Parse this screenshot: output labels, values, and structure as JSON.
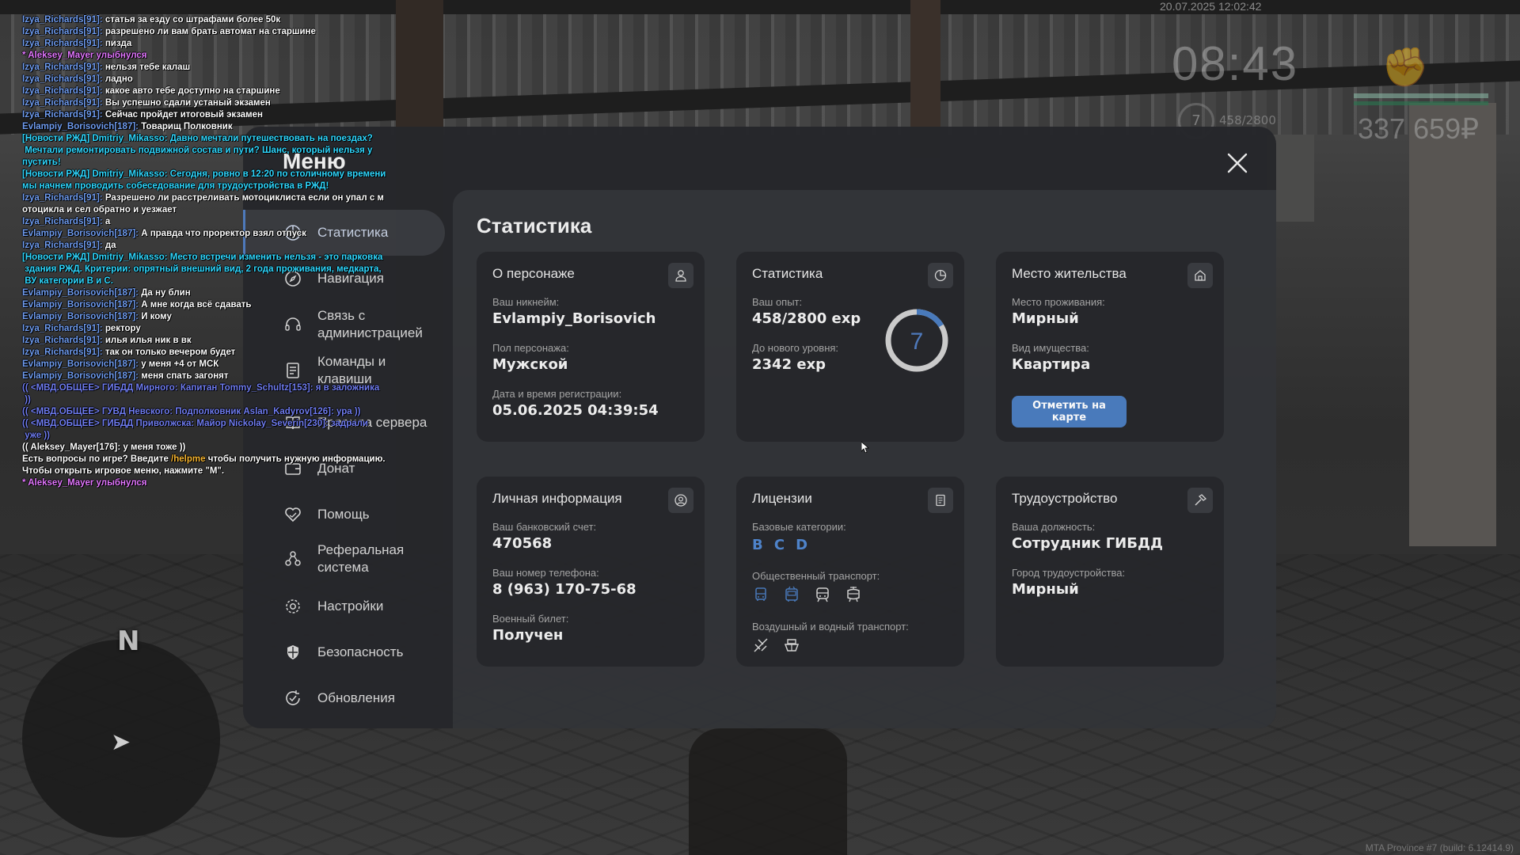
{
  "hud": {
    "datetime": "20.07.2025 12:02:42",
    "clock": "08:43",
    "level": "7",
    "exp": "458/2800",
    "money": "337 659₽",
    "build": "MTA Province #7 (build: 6.12414.9)",
    "compass_letter": "N",
    "fist_icon": "fist-icon"
  },
  "menu": {
    "title": "Меню",
    "section_title": "Статистика",
    "sidebar": [
      {
        "label": "Статистика",
        "icon": "pie-chart-icon",
        "active": true
      },
      {
        "label": "Навигация",
        "icon": "compass-icon",
        "active": false
      },
      {
        "label": "Связь с администрацией",
        "icon": "headset-icon",
        "active": false
      },
      {
        "label": "Команды и клавиши",
        "icon": "document-icon",
        "active": false
      },
      {
        "label": "Правила сервера",
        "icon": "book-icon",
        "active": false
      },
      {
        "label": "Донат",
        "icon": "wallet-icon",
        "active": false
      },
      {
        "label": "Помощь",
        "icon": "heart-hand-icon",
        "active": false
      },
      {
        "label": "Реферальная система",
        "icon": "users-icon",
        "active": false
      },
      {
        "label": "Настройки",
        "icon": "gear-icon",
        "active": false
      },
      {
        "label": "Безопасность",
        "icon": "shield-icon",
        "active": false
      },
      {
        "label": "Обновления",
        "icon": "refresh-check-icon",
        "active": false
      }
    ],
    "cards": {
      "character": {
        "title": "О персонаже",
        "nickname_label": "Ваш никнейм:",
        "nickname": "Evlampiy_Borisovich",
        "gender_label": "Пол персонажа:",
        "gender": "Мужской",
        "reg_label": "Дата и время регистрации:",
        "reg": "05.06.2025 04:39:54"
      },
      "stats": {
        "title": "Статистика",
        "exp_label": "Ваш опыт:",
        "exp": "458/2800 exp",
        "next_label": "До нового уровня:",
        "next": "2342 exp",
        "level": "7",
        "progress": 0.1636
      },
      "residence": {
        "title": "Место жительства",
        "place_label": "Место проживания:",
        "place": "Мирный",
        "property_label": "Вид имущества:",
        "property": "Квартира",
        "button": "Отметить на карте"
      },
      "personal": {
        "title": "Личная информация",
        "bank_label": "Ваш банковский счет:",
        "bank": "470568",
        "phone_label": "Ваш номер телефона:",
        "phone": "8 (963) 170-75-68",
        "military_label": "Военный билет:",
        "military": "Получен"
      },
      "licenses": {
        "title": "Лицензии",
        "base_label": "Базовые категории:",
        "categories": [
          "B",
          "C",
          "D"
        ],
        "public_label": "Общественный транспорт:",
        "public_icons": [
          "bus-icon",
          "trolleybus-icon",
          "train-icon",
          "tram-icon"
        ],
        "air_label": "Воздушный и водный транспорт:",
        "air_icons": [
          "plane-icon",
          "boat-icon"
        ]
      },
      "job": {
        "title": "Трудоустройство",
        "position_label": "Ваша должность:",
        "position": "Сотрудник ГИБДД",
        "city_label": "Город трудоустройства:",
        "city": "Мирный"
      }
    }
  },
  "chat": [
    {
      "cls": "c-name",
      "name": "Izya_Richards[91]:",
      "text": " статья за езду со штрафами более 50к"
    },
    {
      "cls": "c-name",
      "name": "Izya_Richards[91]:",
      "text": " разрешено ли вам брать автомат на старшине"
    },
    {
      "cls": "c-name",
      "name": "Izya_Richards[91]:",
      "text": " пизда"
    },
    {
      "cls": "c-me",
      "name": "",
      "text": "* Aleksey_Mayer улыбнулся"
    },
    {
      "cls": "c-name",
      "name": "Izya_Richards[91]:",
      "text": " нельзя тебе калаш"
    },
    {
      "cls": "c-name",
      "name": "Izya_Richards[91]:",
      "text": " ладно"
    },
    {
      "cls": "c-name",
      "name": "Izya_Richards[91]:",
      "text": " какое авто тебе доступно на старшине"
    },
    {
      "cls": "c-name",
      "name": "Izya_Richards[91]:",
      "text": " Вы успешно сдали устаный экзамен"
    },
    {
      "cls": "c-name",
      "name": "Izya_Richards[91]:",
      "text": " Сейчас пройдет итоговый экзамен"
    },
    {
      "cls": "c-name",
      "name": "Evlampiy_Borisovich[187]:",
      "text": " Товарищ Полковник"
    },
    {
      "cls": "c-news",
      "name": "",
      "text": "[Новости РЖД] Dmitriy_Mikasso: Давно мечтали путешествовать на поездах?\n Мечтали ремонтировать подвижной состав и пути? Шанс, который нельзя у\nпустить!"
    },
    {
      "cls": "c-news",
      "name": "",
      "text": "[Новости РЖД] Dmitriy_Mikasso: Сегодня, ровно в 12:20 по столичному времени\nмы начнем проводить собеседование для трудоустройства в РЖД!"
    },
    {
      "cls": "c-name",
      "name": "Izya_Richards[91]:",
      "text": " Разрешено ли расстреливать мотоциклиста если он упал с м\nотоцикла и сел обратно и уезжает"
    },
    {
      "cls": "c-name",
      "name": "Izya_Richards[91]:",
      "text": " а"
    },
    {
      "cls": "c-name",
      "name": "Evlampiy_Borisovich[187]:",
      "text": " А правда что проректор взял отпуск"
    },
    {
      "cls": "c-name",
      "name": "Izya_Richards[91]:",
      "text": " да"
    },
    {
      "cls": "c-news",
      "name": "",
      "text": "[Новости РЖД] Dmitriy_Mikasso: Место встречи изменить нельзя - это парковка\n здания РЖД. Критерии: опрятный внешний вид, 2 года проживания, медкарта,\n ВУ категории B и C."
    },
    {
      "cls": "c-name",
      "name": "Evlampiy_Borisovich[187]:",
      "text": " Да ну блин"
    },
    {
      "cls": "c-name",
      "name": "Evlampiy_Borisovich[187]:",
      "text": " А мне когда всё сдавать"
    },
    {
      "cls": "c-name",
      "name": "Evlampiy_Borisovich[187]:",
      "text": " И кому"
    },
    {
      "cls": "c-name",
      "name": "Izya_Richards[91]:",
      "text": " ректору"
    },
    {
      "cls": "c-name",
      "name": "Izya_Richards[91]:",
      "text": " илья илья ник в вк"
    },
    {
      "cls": "c-name",
      "name": "Izya_Richards[91]:",
      "text": " так он только вечером будет"
    },
    {
      "cls": "c-name",
      "name": "Evlampiy_Borisovich[187]:",
      "text": " у меня +4 от МСК"
    },
    {
      "cls": "c-name",
      "name": "Evlampiy_Borisovich[187]:",
      "text": " меня спать загонят"
    },
    {
      "cls": "c-gov",
      "name": "",
      "text": "(( <МВД.ОБЩЕЕ> ГИБДД Мирного: Капитан Tommy_Schultz[153]: я в заложника\n ))"
    },
    {
      "cls": "c-gov",
      "name": "",
      "text": "(( <МВД.ОБЩЕЕ> ГУВД Невского: Подполковник Aslan_Kadyrov[126]: ура ))"
    },
    {
      "cls": "c-gov",
      "name": "",
      "text": "(( <МВД.ОБЩЕЕ> ГИБДД Приволжска: Майор Nickolay_Severin[230]: задрали\n уже ))"
    },
    {
      "cls": "c-ooc",
      "name": "",
      "text": "(( Aleksey_Mayer[176]: у меня тоже ))"
    },
    {
      "cls": "c-ooc",
      "name": "",
      "text": "Есть вопросы по игре? Введите ",
      "hl": "/helpme",
      "after": " чтобы получить нужную информацию."
    },
    {
      "cls": "c-ooc",
      "name": "",
      "text": "Чтобы открыть игровое меню, нажмите \"M\"."
    },
    {
      "cls": "c-me",
      "name": "",
      "text": "* Aleksey_Mayer улыбнулся"
    }
  ]
}
